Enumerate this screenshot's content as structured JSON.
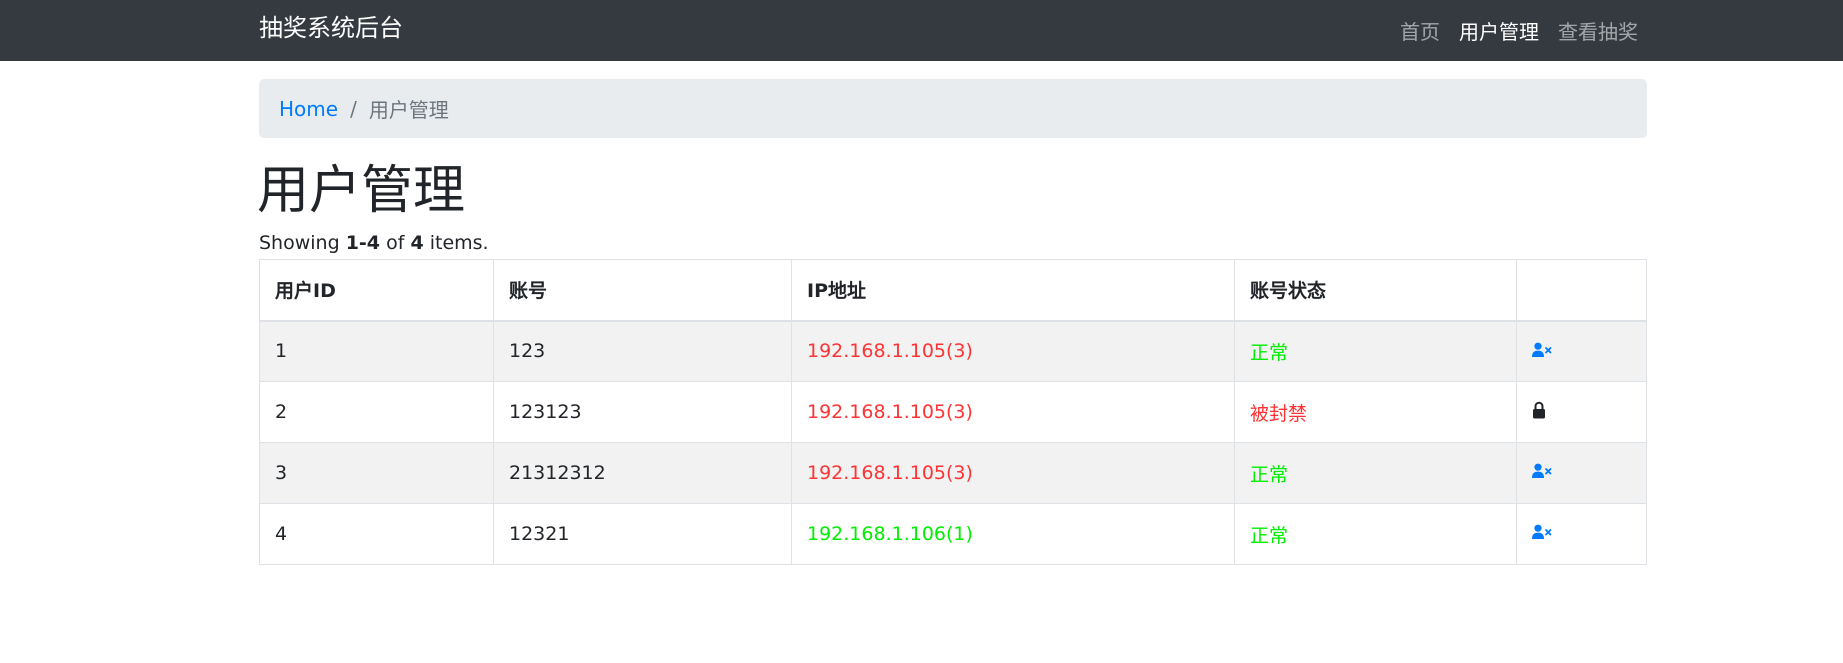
{
  "navbar": {
    "brand": "抽奖系统后台",
    "items": [
      {
        "label": "首页",
        "active": false
      },
      {
        "label": "用户管理",
        "active": true
      },
      {
        "label": "查看抽奖",
        "active": false
      }
    ]
  },
  "breadcrumb": {
    "home": "Home",
    "separator": "/",
    "current": "用户管理"
  },
  "page": {
    "title": "用户管理",
    "summary_prefix": "Showing",
    "summary_range": "1-4",
    "summary_of": "of",
    "summary_total": "4",
    "summary_suffix": "items."
  },
  "table": {
    "headers": [
      "用户ID",
      "账号",
      "IP地址",
      "账号状态",
      ""
    ],
    "rows": [
      {
        "id": "1",
        "account": "123",
        "ip": "192.168.1.105(3)",
        "ip_color": "red",
        "status": "正常",
        "status_color": "green",
        "action_icon": "user-ban-icon"
      },
      {
        "id": "2",
        "account": "123123",
        "ip": "192.168.1.105(3)",
        "ip_color": "red",
        "status": "被封禁",
        "status_color": "red",
        "action_icon": "lock-icon"
      },
      {
        "id": "3",
        "account": "21312312",
        "ip": "192.168.1.105(3)",
        "ip_color": "red",
        "status": "正常",
        "status_color": "green",
        "action_icon": "user-ban-icon"
      },
      {
        "id": "4",
        "account": "12321",
        "ip": "192.168.1.106(1)",
        "ip_color": "green",
        "status": "正常",
        "status_color": "green",
        "action_icon": "user-ban-icon"
      }
    ]
  },
  "colors": {
    "navbar_bg": "#343a40",
    "link": "#007bff",
    "red": "#ff3333",
    "green": "#00ee00"
  }
}
